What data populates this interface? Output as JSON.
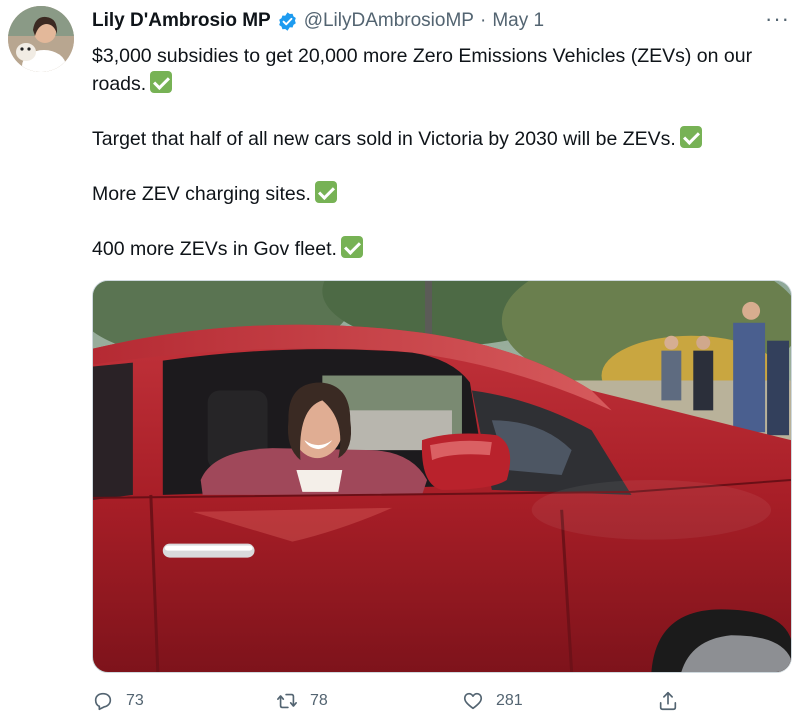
{
  "author": {
    "display_name": "Lily D'Ambrosio MP",
    "handle": "@LilyDAmbrosioMP",
    "separator": "·",
    "date": "May 1",
    "verified": true
  },
  "tweet": {
    "paragraphs": [
      "$3,000 subsidies to get 20,000 more Zero Emissions Vehicles (ZEVs) on our roads.",
      "Target that half of all new cars sold in Victoria by 2030 will be ZEVs.",
      "More ZEV charging sites.",
      "400 more ZEVs in Gov fleet."
    ]
  },
  "actions": {
    "reply_count": "73",
    "retweet_count": "78",
    "like_count": "281"
  },
  "icons": {
    "verified": "verified-badge-icon",
    "check": "check-mark-button-icon",
    "more": "more-options-icon",
    "reply": "reply-icon",
    "retweet": "retweet-icon",
    "like": "heart-icon",
    "share": "share-icon"
  },
  "colors": {
    "verified_blue": "#1d9bf0",
    "check_green": "#77b255",
    "secondary_text": "#536471",
    "car_red": "#b3202a"
  }
}
